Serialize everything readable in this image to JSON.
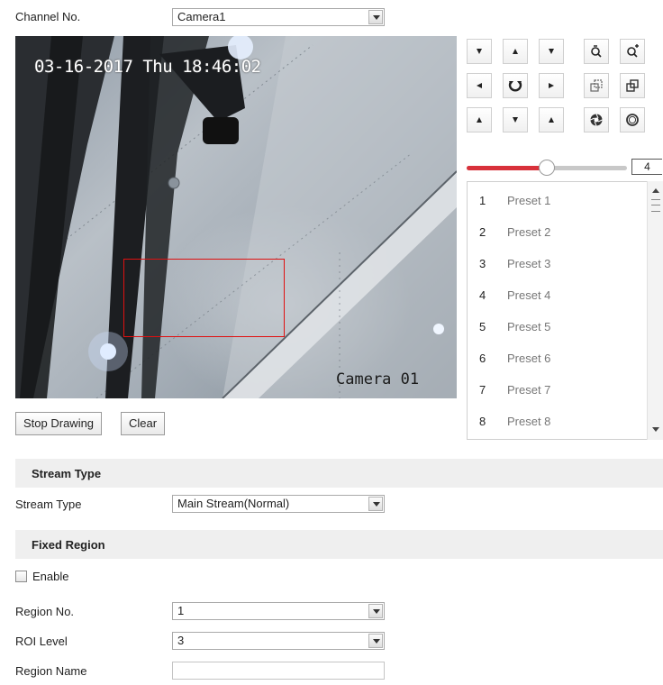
{
  "channel": {
    "label": "Channel No.",
    "value": "Camera1"
  },
  "video": {
    "osd_time": "03-16-2017 Thu 18:46:02",
    "osd_camera": "Camera 01"
  },
  "buttons": {
    "stop_drawing": "Stop Drawing",
    "clear": "Clear"
  },
  "ptz": {
    "icons": [
      "arrow-up-left-icon",
      "arrow-up-icon",
      "arrow-up-right-icon",
      "zoom-in-icon",
      "zoom-out-icon",
      "arrow-left-icon",
      "auto-pan-icon",
      "arrow-right-icon",
      "focus-near-icon",
      "focus-far-icon",
      "arrow-down-left-icon",
      "arrow-down-icon",
      "arrow-down-right-icon",
      "iris-open-icon",
      "iris-close-icon"
    ],
    "speed_value": "4",
    "speed_fraction": 0.5,
    "accent_color": "#d8313b"
  },
  "presets": [
    {
      "num": "1",
      "name": "Preset 1"
    },
    {
      "num": "2",
      "name": "Preset 2"
    },
    {
      "num": "3",
      "name": "Preset 3"
    },
    {
      "num": "4",
      "name": "Preset 4"
    },
    {
      "num": "5",
      "name": "Preset 5"
    },
    {
      "num": "6",
      "name": "Preset 6"
    },
    {
      "num": "7",
      "name": "Preset 7"
    },
    {
      "num": "8",
      "name": "Preset 8"
    }
  ],
  "stream_section": {
    "title": "Stream Type",
    "label": "Stream Type",
    "value": "Main Stream(Normal)"
  },
  "fixed_section": {
    "title": "Fixed Region",
    "enable_label": "Enable",
    "enable_checked": false,
    "region_no_label": "Region No.",
    "region_no_value": "1",
    "roi_level_label": "ROI Level",
    "roi_level_value": "3",
    "region_name_label": "Region Name",
    "region_name_value": ""
  }
}
